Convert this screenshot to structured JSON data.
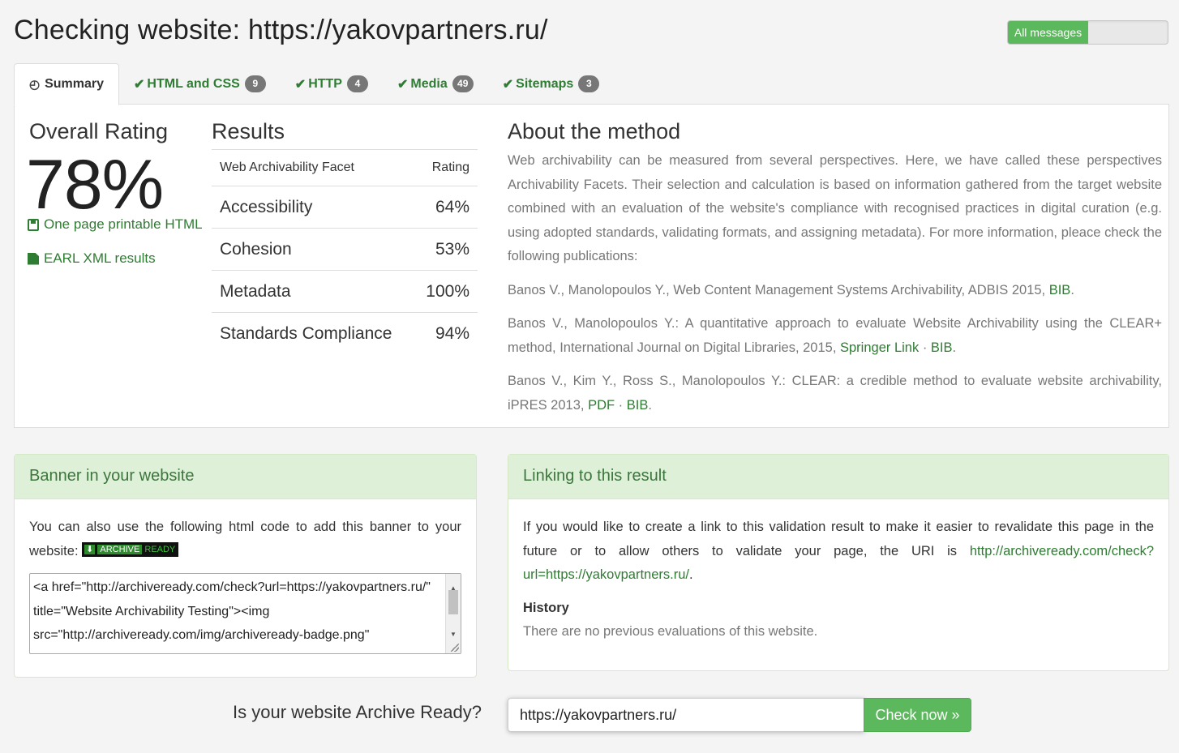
{
  "page_title": "Checking website: https://yakovpartners.ru/",
  "toggle": {
    "on_label": "All messages"
  },
  "tabs": [
    {
      "label": "Summary",
      "icon": "dashboard-icon",
      "active": true
    },
    {
      "label": "HTML and CSS",
      "badge": "9",
      "icon": "check-icon"
    },
    {
      "label": "HTTP",
      "badge": "4",
      "icon": "check-icon"
    },
    {
      "label": "Media",
      "badge": "49",
      "icon": "check-icon"
    },
    {
      "label": "Sitemaps",
      "badge": "3",
      "icon": "check-icon"
    }
  ],
  "overall": {
    "title": "Overall Rating",
    "value": "78%",
    "printable_link": "One page printable HTML",
    "earl_link": "EARL XML results"
  },
  "results": {
    "title": "Results",
    "col_facet": "Web Archivability Facet",
    "col_rating": "Rating",
    "rows": [
      {
        "facet": "Accessibility",
        "rating": "64%"
      },
      {
        "facet": "Cohesion",
        "rating": "53%"
      },
      {
        "facet": "Metadata",
        "rating": "100%"
      },
      {
        "facet": "Standards Compliance",
        "rating": "94%"
      }
    ]
  },
  "about": {
    "title": "About the method",
    "intro": "Web archivability can be measured from several perspectives. Here, we have called these perspectives Archivability Facets. Their selection and calculation is based on information gathered from the target website combined with an evaluation of the website's compliance with recognised practices in digital curation (e.g. using adopted standards, validating formats, and assigning metadata). For more information, pleace check the following publications:",
    "pub1_text": "Banos V., Manolopoulos Y., Web Content Management Systems Archivability, ADBIS 2015, ",
    "pub1_bib": "BIB",
    "pub2_text": "Banos V., Manolopoulos Y.: A quantitative approach to evaluate Website Archivability using the CLEAR+ method, International Journal on Digital Libraries, 2015, ",
    "pub2_springer": "Springer Link",
    "pub2_bib": "BIB",
    "pub3_text": "Banos V., Kim Y., Ross S., Manolopoulos Y.: CLEAR: a credible method to evaluate website archivability, iPRES 2013, ",
    "pub3_pdf": "PDF",
    "pub3_bib": "BIB",
    "sep": " · ",
    "end": "."
  },
  "banner": {
    "heading": "Banner in your website",
    "text": "You can also use the following html code to add this banner to your website: ",
    "badge_left": "ARCHIVE",
    "badge_right": "READY",
    "code": "<a href=\"http://archiveready.com/check?url=https://yakovpartners.ru/\" title=\"Website Archivability Testing\"><img src=\"http://archiveready.com/img/archiveready-badge.png\""
  },
  "linking": {
    "heading": "Linking to this result",
    "text": "If you would like to create a link to this validation result to make it easier to revalidate this page in the future or to allow others to validate your page, the URI is ",
    "uri": "http://archiveready.com/check?url=https://yakovpartners.ru/",
    "end": ".",
    "history_title": "History",
    "history_text": "There are no previous evaluations of this website."
  },
  "check": {
    "question": "Is your website Archive Ready?",
    "url_value": "https://yakovpartners.ru/",
    "button_label": "Check now »"
  },
  "colors": {
    "accent_green": "#5cb85c",
    "link_green": "#2e7d32",
    "panel_green": "#dff0d8",
    "badge_gray": "#777777"
  }
}
